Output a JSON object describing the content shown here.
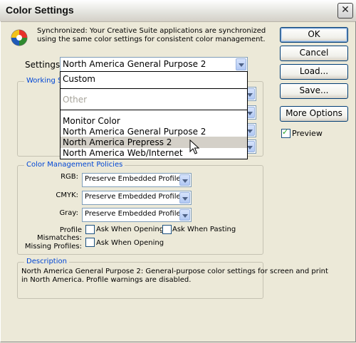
{
  "window": {
    "title": "Color Settings",
    "close_glyph": "✕"
  },
  "sync": {
    "icon": "color-sync-icon",
    "text": "Synchronized: Your Creative Suite applications are synchronized using the same color settings for consistent color management."
  },
  "buttons": {
    "ok": "OK",
    "cancel": "Cancel",
    "load": "Load...",
    "save": "Save...",
    "more_options": "More Options"
  },
  "preview": {
    "label": "Preview",
    "checked": true
  },
  "settings": {
    "label": "Settings:",
    "value": "North America General Purpose 2"
  },
  "working_spaces": {
    "legend": "Working S"
  },
  "dropdown": {
    "items": [
      {
        "label": "Custom"
      },
      {
        "label": "Other",
        "disabled": true
      },
      {
        "label": "Monitor Color"
      },
      {
        "label": "North America General Purpose 2"
      },
      {
        "label": "North America Prepress 2",
        "selected": true
      },
      {
        "label": "North America Web/Internet"
      }
    ]
  },
  "policies": {
    "legend": "Color Management Policies",
    "rgb": {
      "label": "RGB:",
      "value": "Preserve Embedded Profiles"
    },
    "cmyk": {
      "label": "CMYK:",
      "value": "Preserve Embedded Profiles"
    },
    "gray": {
      "label": "Gray:",
      "value": "Preserve Embedded Profiles"
    },
    "mismatches": {
      "label": "Profile Mismatches:",
      "ask_opening": "Ask When Opening",
      "ask_pasting": "Ask When Pasting"
    },
    "missing": {
      "label": "Missing Profiles:",
      "ask_opening": "Ask When Opening"
    }
  },
  "description": {
    "legend": "Description",
    "text": "North America General Purpose 2:  General-purpose color settings for screen and print in North America. Profile warnings are disabled."
  }
}
